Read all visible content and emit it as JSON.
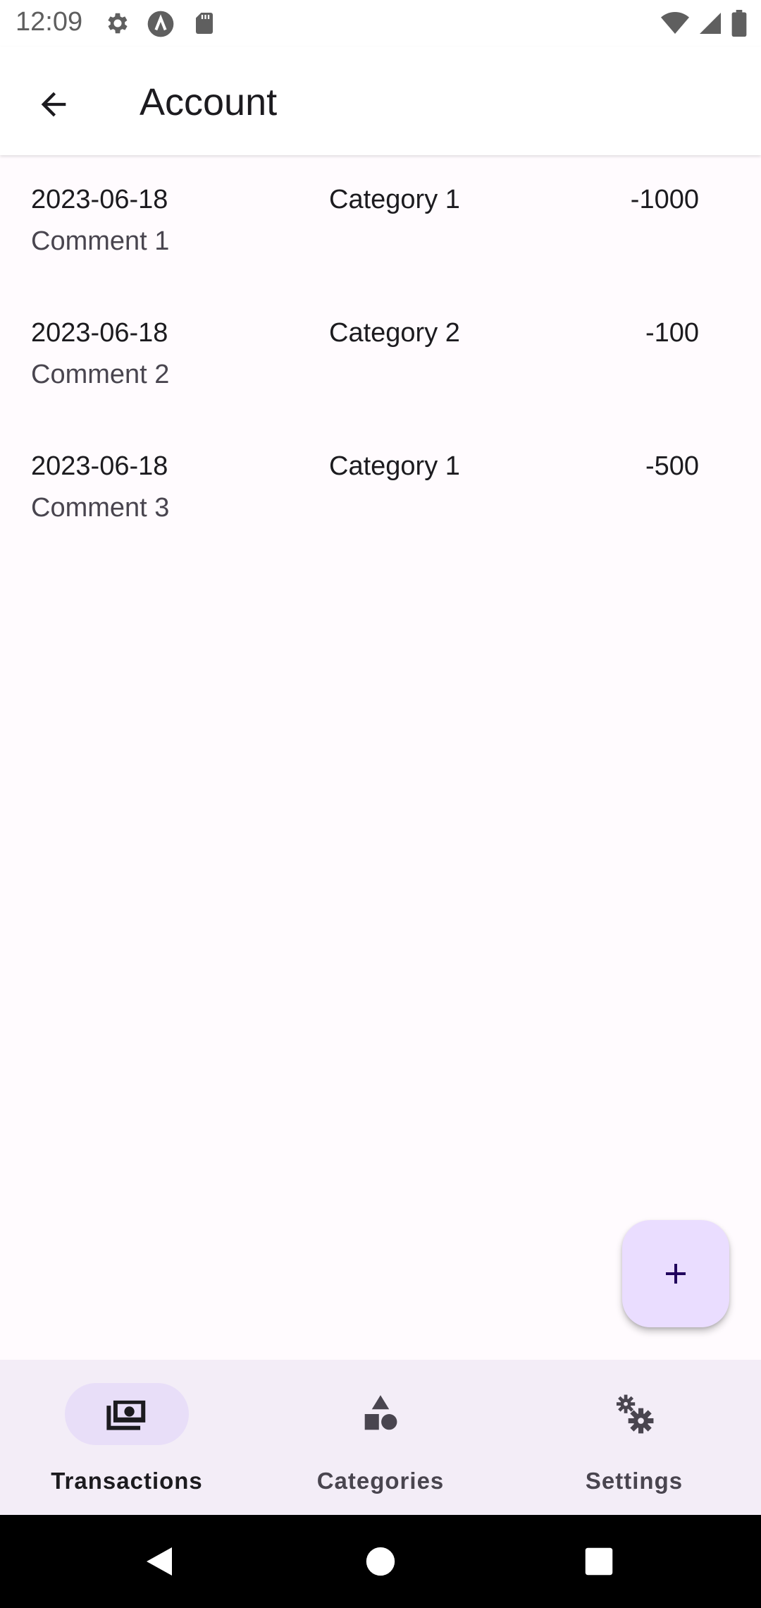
{
  "status_bar": {
    "time": "12:09",
    "icons_left": [
      "settings-gear-icon",
      "a-letter-icon",
      "sd-card-icon"
    ],
    "icons_right": [
      "wifi-icon",
      "signal-icon",
      "battery-icon"
    ]
  },
  "app_bar": {
    "title": "Account",
    "back_icon": "arrow-back-icon"
  },
  "transactions": [
    {
      "date": "2023-06-18",
      "comment": "Comment 1",
      "category": "Category 1",
      "amount": "-1000"
    },
    {
      "date": "2023-06-18",
      "comment": "Comment 2",
      "category": "Category 2",
      "amount": "-100"
    },
    {
      "date": "2023-06-18",
      "comment": "Comment 3",
      "category": "Category 1",
      "amount": "-500"
    }
  ],
  "fab": {
    "icon": "plus-icon"
  },
  "bottom_nav": {
    "items": [
      {
        "label": "Transactions",
        "icon": "money-icon",
        "active": true
      },
      {
        "label": "Categories",
        "icon": "shapes-icon",
        "active": false
      },
      {
        "label": "Settings",
        "icon": "gears-icon",
        "active": false
      }
    ]
  },
  "system_nav": [
    "back-triangle-icon",
    "home-circle-icon",
    "recents-square-icon"
  ],
  "colors": {
    "background": "#fffbfe",
    "fab": "#eaddff",
    "nav_bar": "#f3edf7",
    "nav_active_pill": "#e8def8",
    "text_primary": "#1c1b1f",
    "text_secondary": "#49454f"
  }
}
